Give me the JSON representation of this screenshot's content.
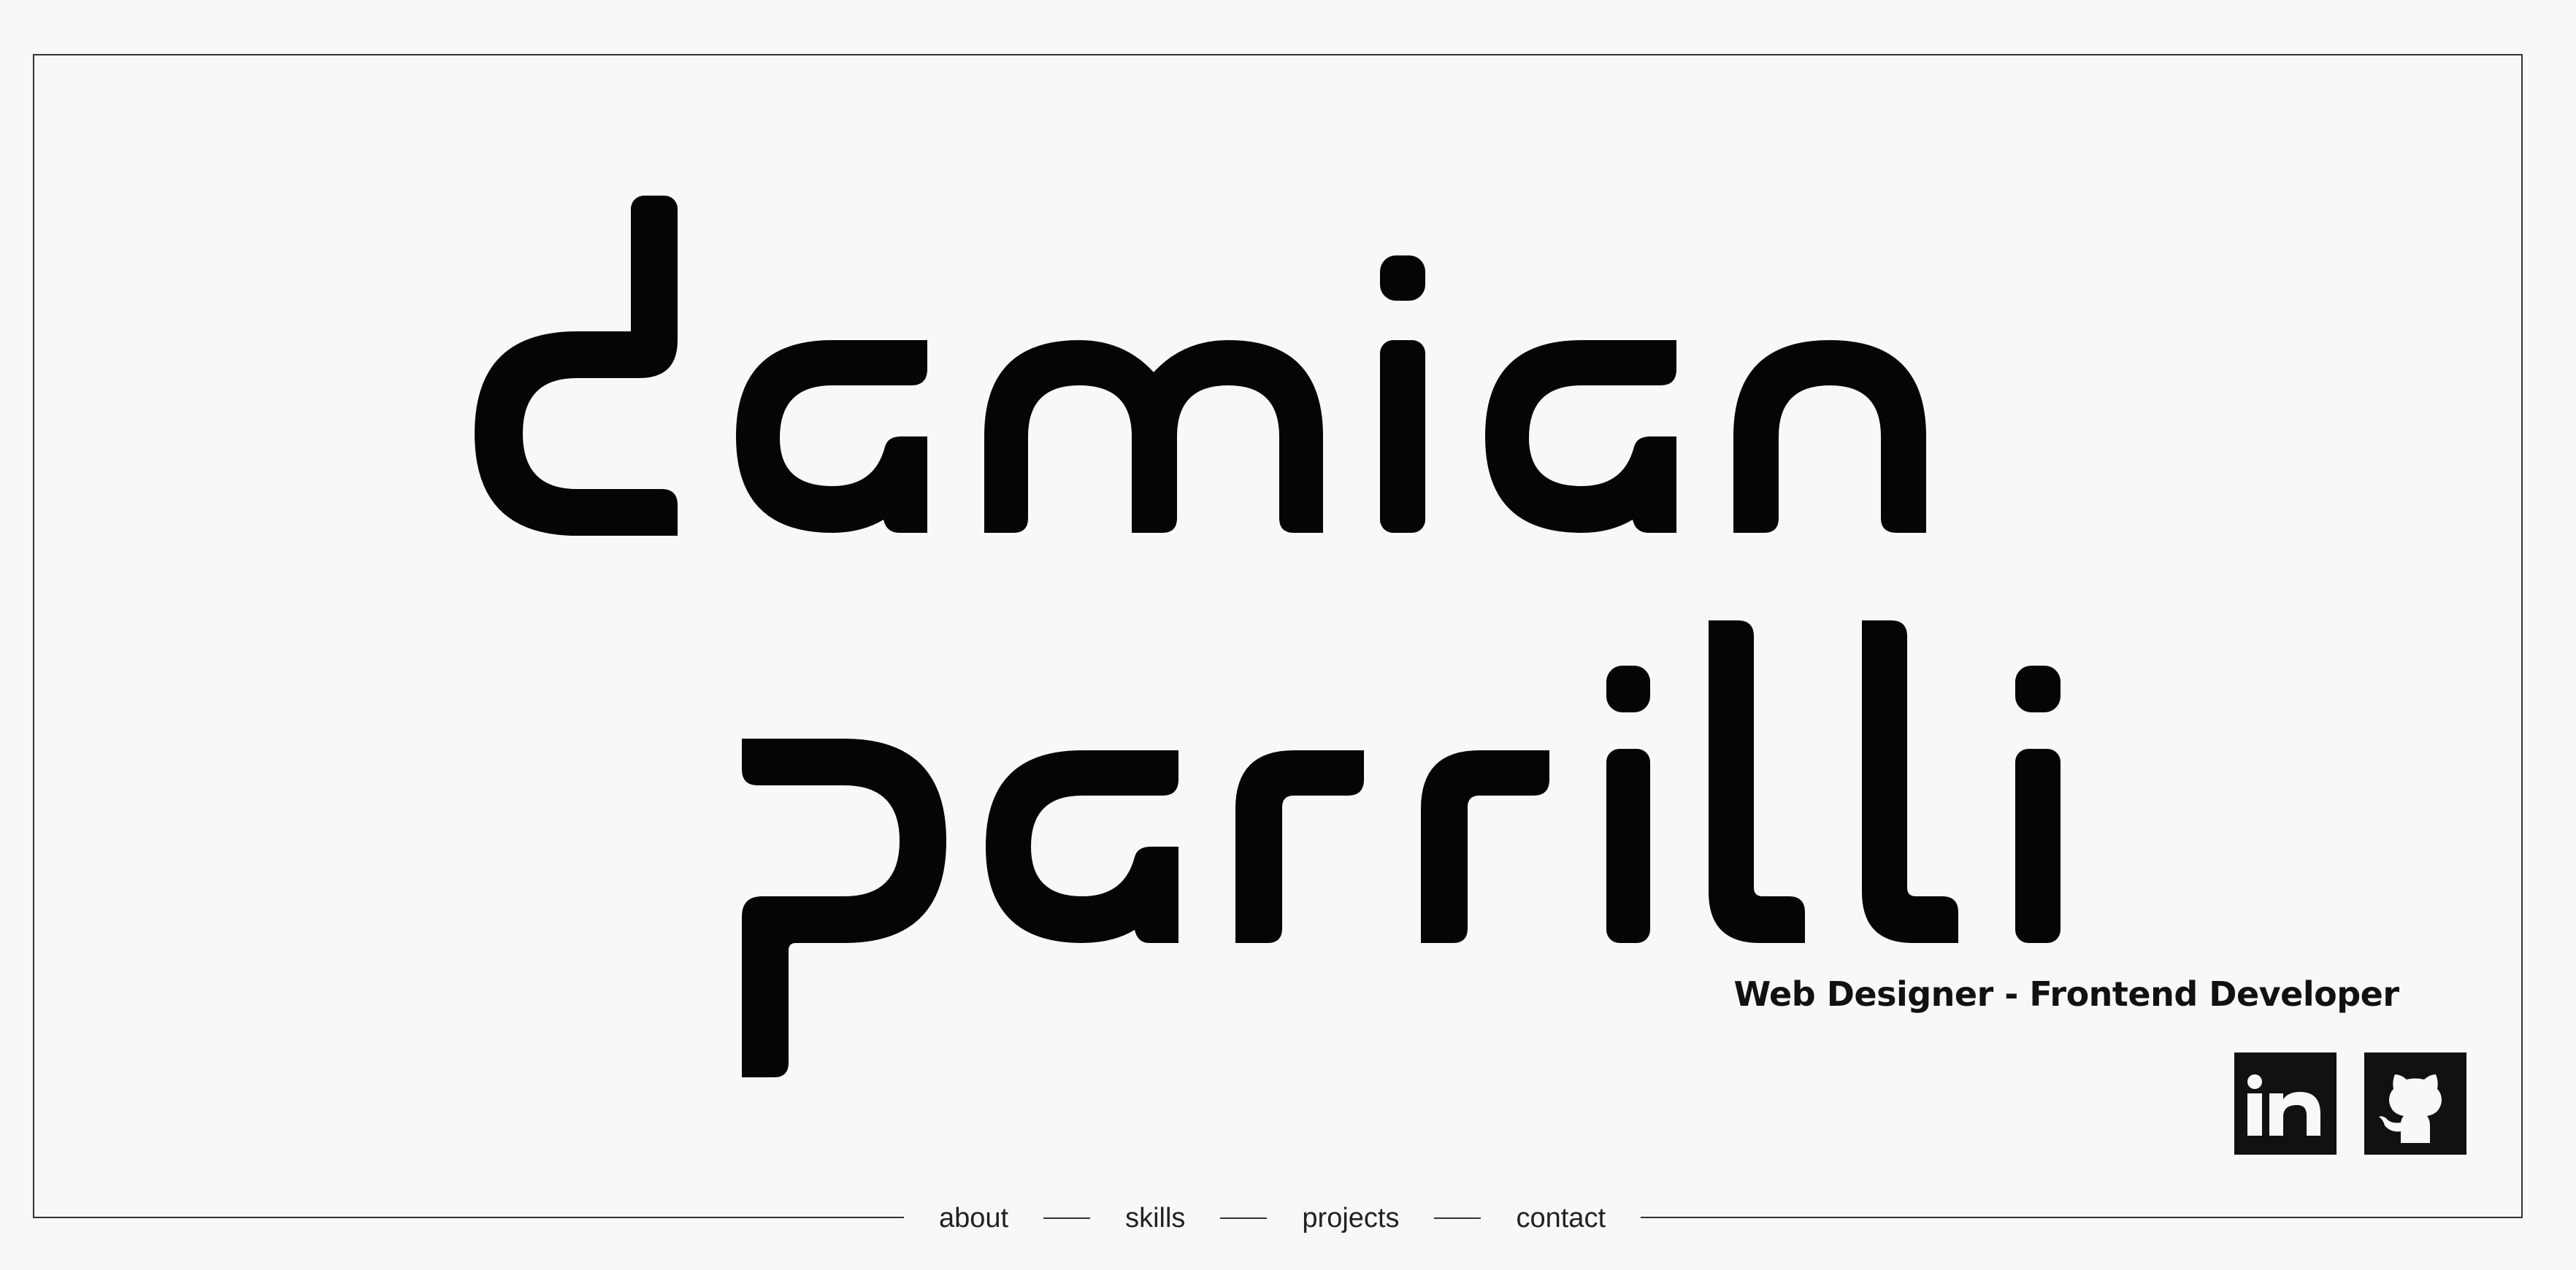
{
  "brand": {
    "first_name": "damian",
    "last_name": "parrilli"
  },
  "tagline": "Web Designer - Frontend Developer",
  "social": [
    {
      "name": "LinkedIn",
      "icon": "linkedin-icon"
    },
    {
      "name": "GitHub",
      "icon": "github-icon"
    }
  ],
  "nav": {
    "items": [
      {
        "label": "about"
      },
      {
        "label": "skills"
      },
      {
        "label": "projects"
      },
      {
        "label": "contact"
      }
    ]
  },
  "colors": {
    "background": "#f8f8f8",
    "ink": "#111111",
    "border": "#333333"
  }
}
